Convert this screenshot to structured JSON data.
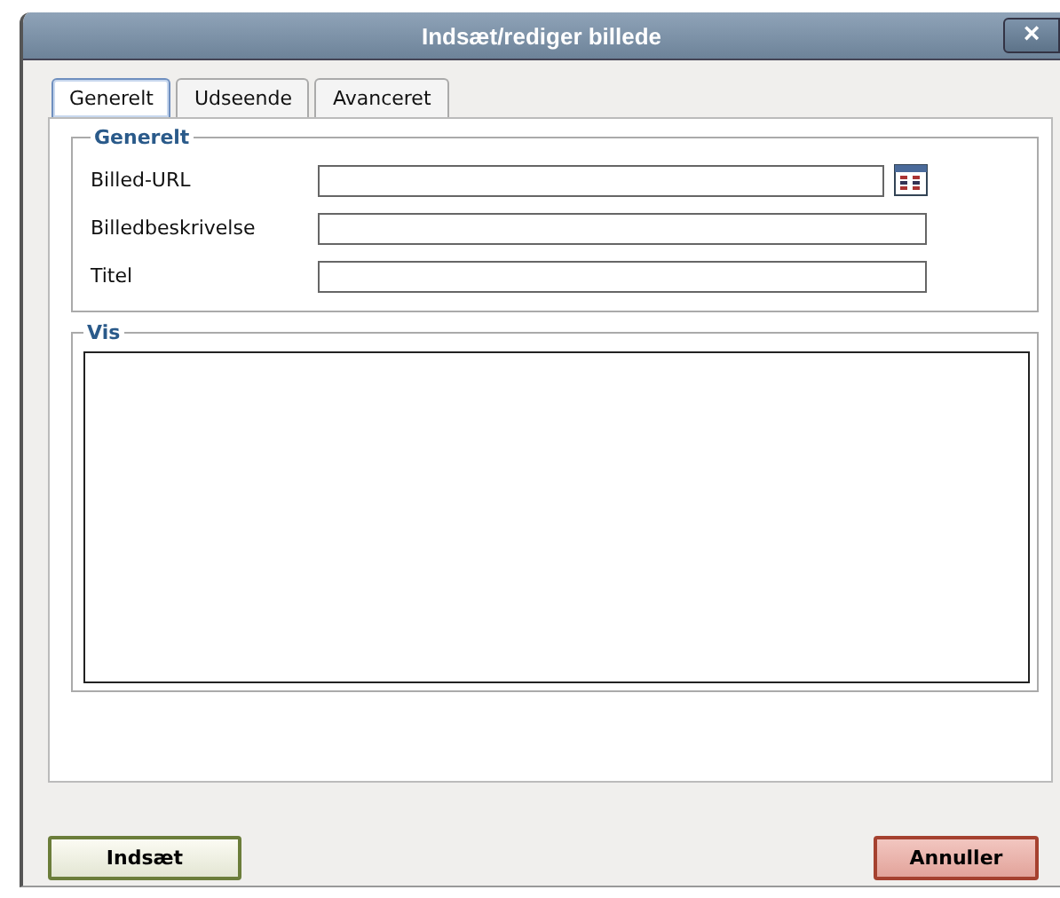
{
  "window": {
    "title": "Indsæt/rediger billede",
    "close": "×"
  },
  "tabs": [
    {
      "label": "Generelt",
      "selected": true
    },
    {
      "label": "Udseende",
      "selected": false
    },
    {
      "label": "Avanceret",
      "selected": false
    }
  ],
  "general": {
    "legend": "Generelt",
    "fields": [
      {
        "label": "Billed-URL",
        "browse": true
      },
      {
        "label": "Billedbeskrivelse",
        "browse": false
      },
      {
        "label": "Titel",
        "browse": false
      }
    ]
  },
  "preview": {
    "legend": "Vis"
  },
  "buttons": {
    "insert": "Indsæt",
    "cancel": "Annuller"
  }
}
